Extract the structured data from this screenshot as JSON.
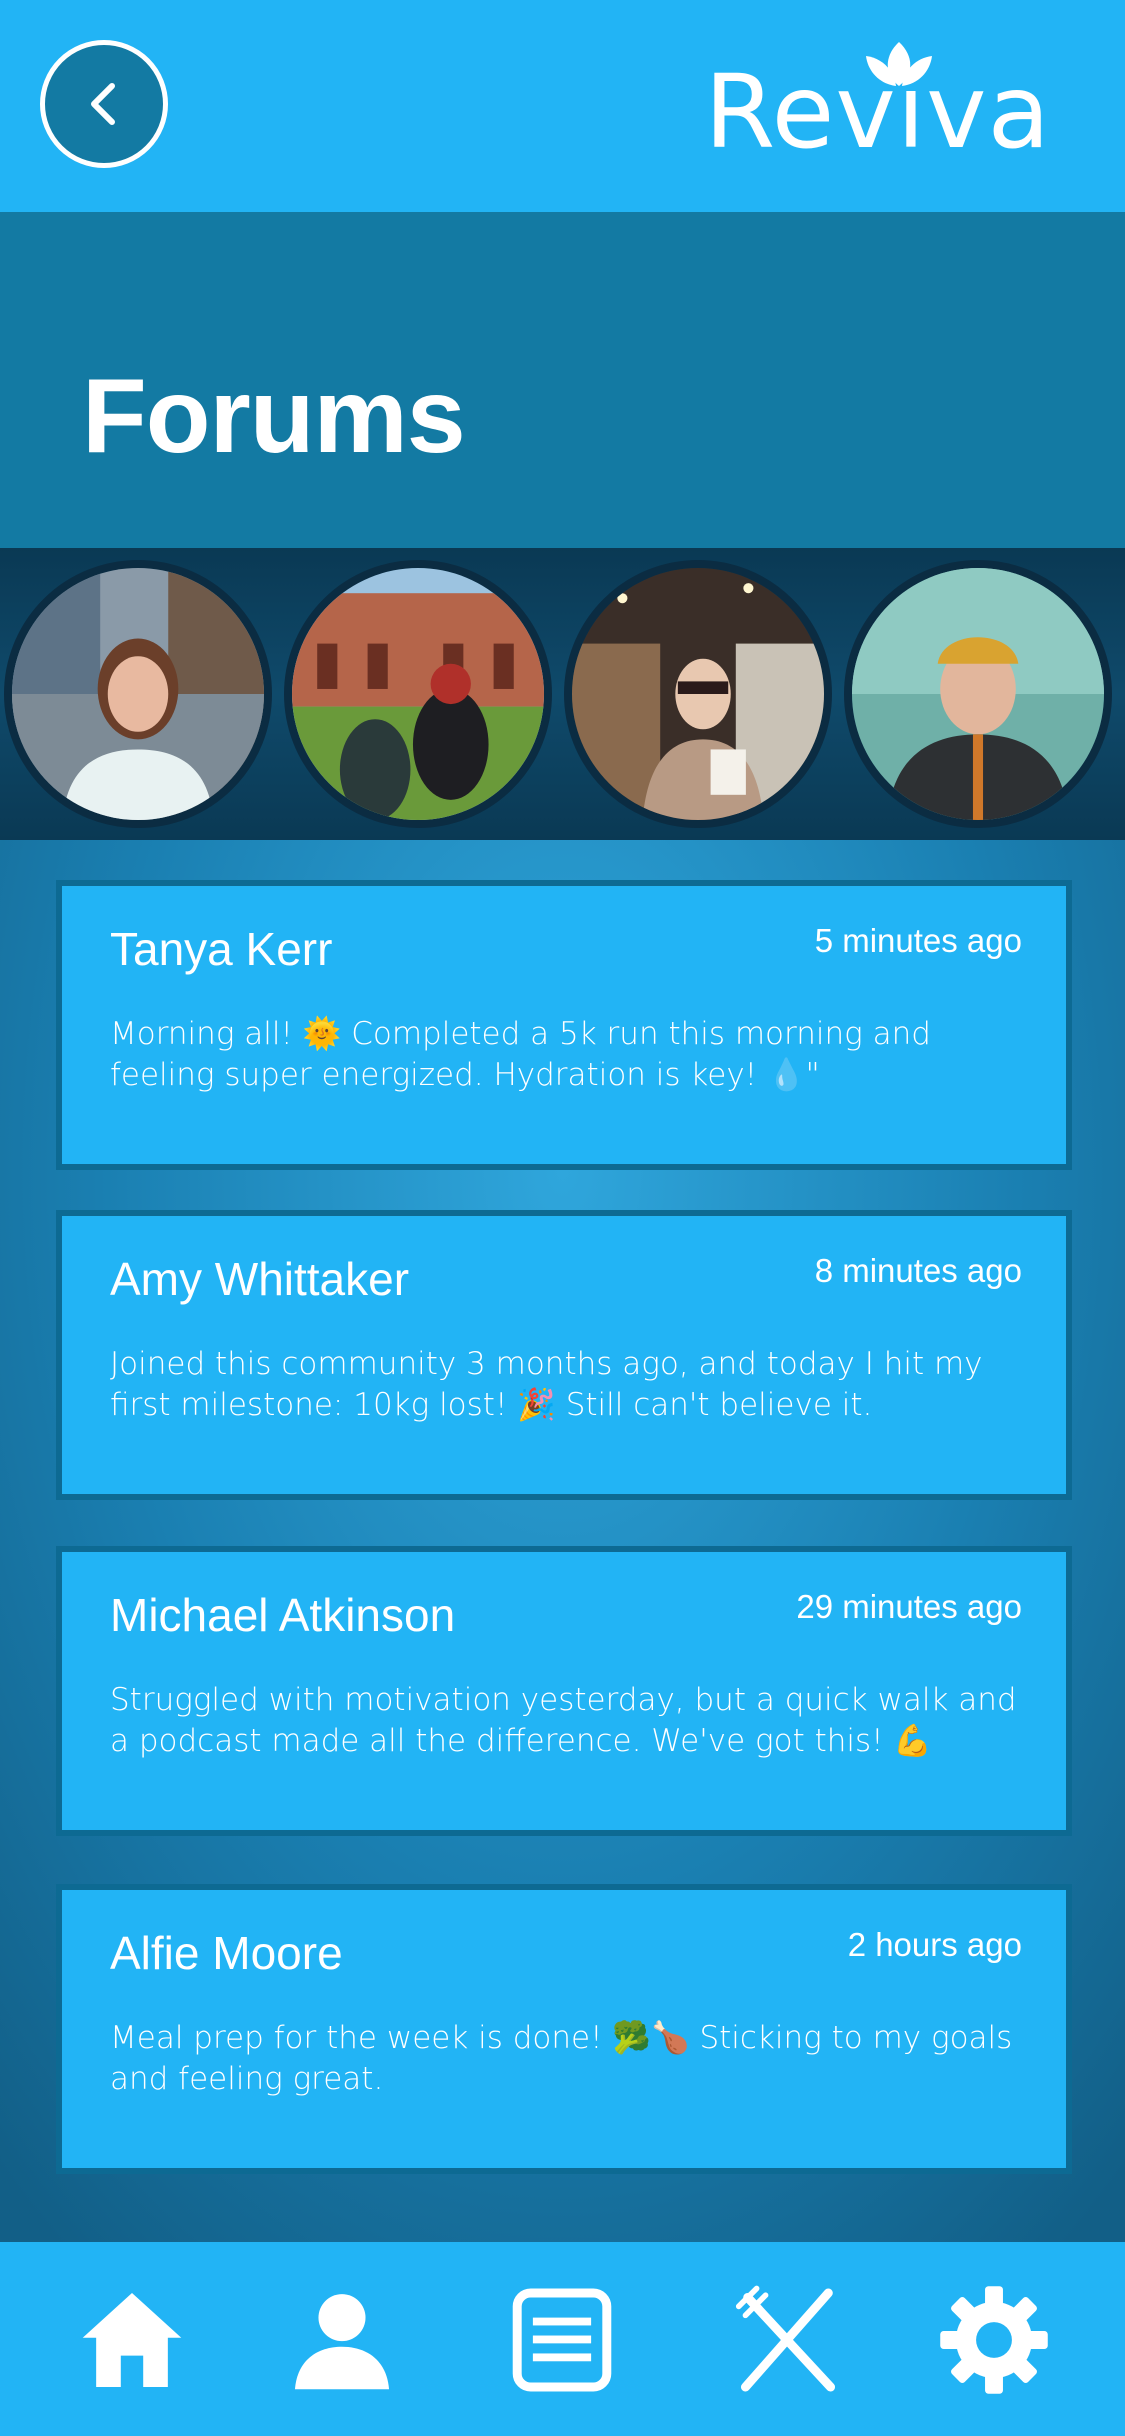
{
  "header": {
    "back_label": "Back",
    "brand": "Reviva"
  },
  "page": {
    "title": "Forums"
  },
  "avatars": [
    {
      "name": "avatar-1"
    },
    {
      "name": "avatar-2"
    },
    {
      "name": "avatar-3"
    },
    {
      "name": "avatar-4"
    }
  ],
  "posts": [
    {
      "author": "Tanya Kerr",
      "time": "5 minutes ago",
      "body": "Morning all! 🌞 Completed a 5k run this morning and feeling super energized. Hydration is key! 💧\""
    },
    {
      "author": "Amy Whittaker",
      "time": "8 minutes ago",
      "body": "Joined this community 3 months ago, and today I hit my first milestone: 10kg lost! 🎉 Still can't believe it."
    },
    {
      "author": "Michael Atkinson",
      "time": "29 minutes ago",
      "body": "Struggled with motivation yesterday, but a quick walk and a podcast made all the difference. We've got this! 💪"
    },
    {
      "author": "Alfie Moore",
      "time": "2 hours ago",
      "body": "Meal prep for the week is done! 🥦🍗 Sticking to my goals and feeling great."
    }
  ],
  "nav": {
    "icons": [
      "home-icon",
      "profile-icon",
      "forums-icon",
      "meals-icon",
      "settings-icon"
    ]
  },
  "colors": {
    "primary": "#22b4f5",
    "dark": "#137aa3",
    "card_border": "#0d6a93"
  }
}
